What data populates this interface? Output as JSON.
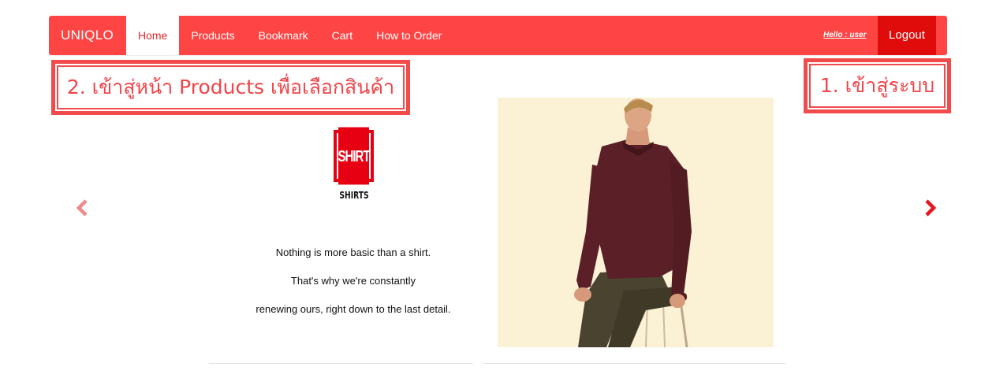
{
  "navbar": {
    "brand": "UNIQLO",
    "items": [
      {
        "label": "Home",
        "active": true
      },
      {
        "label": "Products",
        "active": false
      },
      {
        "label": "Bookmark",
        "active": false
      },
      {
        "label": "Cart",
        "active": false
      },
      {
        "label": "How to Order",
        "active": false
      }
    ],
    "greeting": "Hello : user",
    "logout_label": "Logout"
  },
  "annotations": {
    "products_step": "2. เข้าสู่หน้า Products เพื่อเลือกสินค้า",
    "login_step": "1. เข้าสู่ระบบ"
  },
  "carousel": {
    "logo_text": "SHIRT",
    "category_title": "SHIRTS",
    "description": [
      "Nothing is more basic than a shirt.",
      "That's why we're constantly",
      "renewing ours, right down to the last detail."
    ],
    "prev_icon": "chevron-left-icon",
    "next_icon": "chevron-right-icon"
  },
  "colors": {
    "navbar_bg": "#ff4444",
    "logout_bg": "#e00c0c",
    "active_text": "#e8262a",
    "annotation_border": "#f24b4b",
    "brand_red": "#e60012"
  }
}
